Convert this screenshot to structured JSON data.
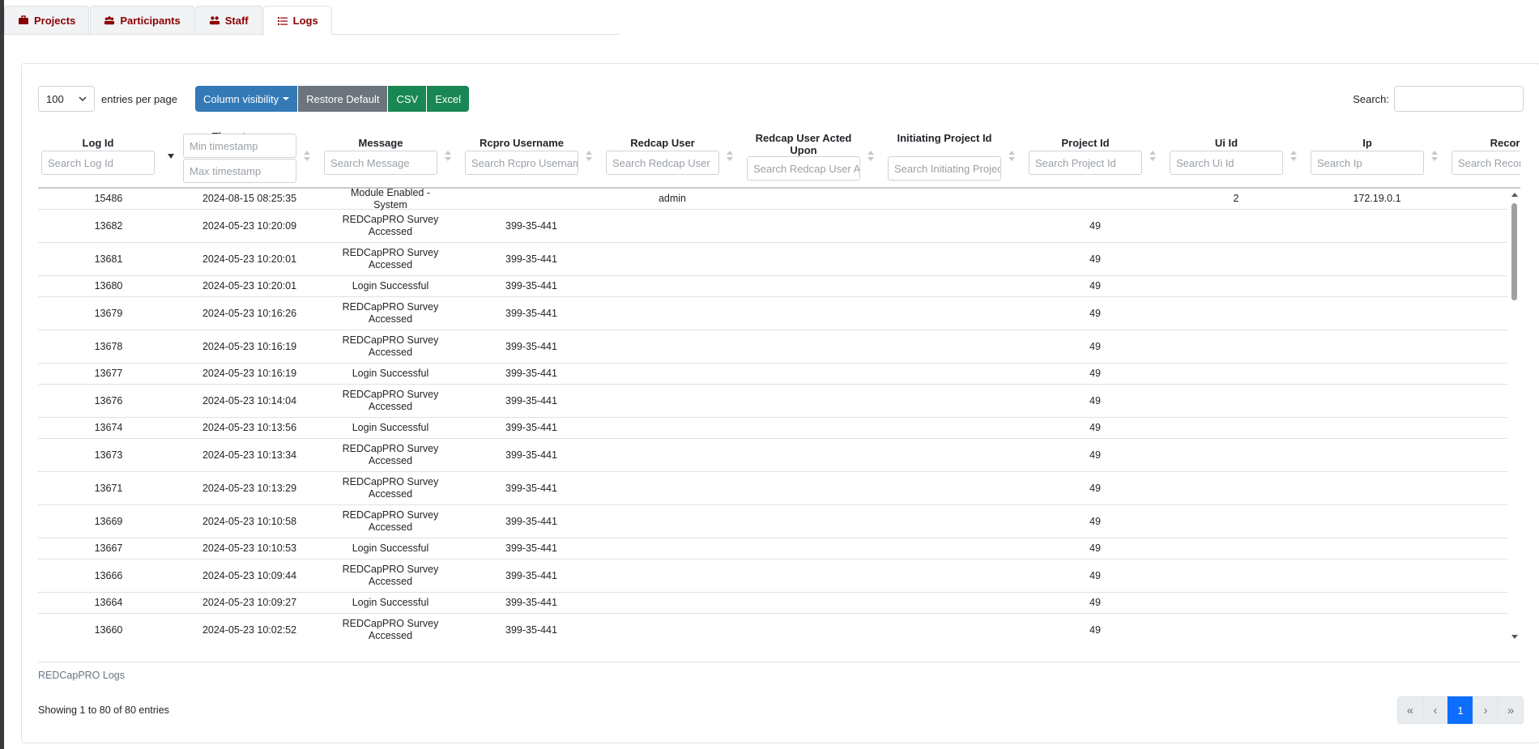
{
  "tabs": [
    {
      "label": "Projects",
      "icon": "briefcase-icon"
    },
    {
      "label": "Participants",
      "icon": "users-icon"
    },
    {
      "label": "Staff",
      "icon": "user-group-icon"
    },
    {
      "label": "Logs",
      "icon": "list-icon"
    }
  ],
  "toolbar": {
    "page_length": "100",
    "page_length_label": "entries per page",
    "column_visibility": "Column visibility",
    "restore_default": "Restore Default",
    "csv": "CSV",
    "excel": "Excel",
    "search_label": "Search:"
  },
  "columns": [
    {
      "title": "Log Id",
      "placeholder": "Search Log Id"
    },
    {
      "title": "Timestamp",
      "placeholder": "Min timestamp",
      "placeholder2": "Max timestamp"
    },
    {
      "title": "Message",
      "placeholder": "Search Message"
    },
    {
      "title": "Rcpro Username",
      "placeholder": "Search Rcpro Username"
    },
    {
      "title": "Redcap User",
      "placeholder": "Search Redcap User"
    },
    {
      "title": "Redcap User Acted Upon",
      "placeholder": "Search Redcap User Acted Upon"
    },
    {
      "title": "Initiating Project Id",
      "placeholder": "Search Initiating Project Id"
    },
    {
      "title": "Project Id",
      "placeholder": "Search Project Id"
    },
    {
      "title": "Ui Id",
      "placeholder": "Search Ui Id"
    },
    {
      "title": "Ip",
      "placeholder": "Search Ip"
    },
    {
      "title": "Record",
      "placeholder": "Search Record"
    }
  ],
  "rows": [
    {
      "log_id": "15486",
      "timestamp": "2024-08-15 08:25:35",
      "message": "Module Enabled - System",
      "rcpro_username": "",
      "redcap_user": "admin",
      "project_id": "",
      "ui_id": "2",
      "ip": "172.19.0.1"
    },
    {
      "log_id": "13682",
      "timestamp": "2024-05-23 10:20:09",
      "message": "REDCapPRO Survey Accessed",
      "rcpro_username": "399-35-441",
      "redcap_user": "",
      "project_id": "49",
      "ui_id": "",
      "ip": ""
    },
    {
      "log_id": "13681",
      "timestamp": "2024-05-23 10:20:01",
      "message": "REDCapPRO Survey Accessed",
      "rcpro_username": "399-35-441",
      "redcap_user": "",
      "project_id": "49",
      "ui_id": "",
      "ip": ""
    },
    {
      "log_id": "13680",
      "timestamp": "2024-05-23 10:20:01",
      "message": "Login Successful",
      "rcpro_username": "399-35-441",
      "redcap_user": "",
      "project_id": "49",
      "ui_id": "",
      "ip": ""
    },
    {
      "log_id": "13679",
      "timestamp": "2024-05-23 10:16:26",
      "message": "REDCapPRO Survey Accessed",
      "rcpro_username": "399-35-441",
      "redcap_user": "",
      "project_id": "49",
      "ui_id": "",
      "ip": ""
    },
    {
      "log_id": "13678",
      "timestamp": "2024-05-23 10:16:19",
      "message": "REDCapPRO Survey Accessed",
      "rcpro_username": "399-35-441",
      "redcap_user": "",
      "project_id": "49",
      "ui_id": "",
      "ip": ""
    },
    {
      "log_id": "13677",
      "timestamp": "2024-05-23 10:16:19",
      "message": "Login Successful",
      "rcpro_username": "399-35-441",
      "redcap_user": "",
      "project_id": "49",
      "ui_id": "",
      "ip": ""
    },
    {
      "log_id": "13676",
      "timestamp": "2024-05-23 10:14:04",
      "message": "REDCapPRO Survey Accessed",
      "rcpro_username": "399-35-441",
      "redcap_user": "",
      "project_id": "49",
      "ui_id": "",
      "ip": ""
    },
    {
      "log_id": "13674",
      "timestamp": "2024-05-23 10:13:56",
      "message": "Login Successful",
      "rcpro_username": "399-35-441",
      "redcap_user": "",
      "project_id": "49",
      "ui_id": "",
      "ip": ""
    },
    {
      "log_id": "13673",
      "timestamp": "2024-05-23 10:13:34",
      "message": "REDCapPRO Survey Accessed",
      "rcpro_username": "399-35-441",
      "redcap_user": "",
      "project_id": "49",
      "ui_id": "",
      "ip": ""
    },
    {
      "log_id": "13671",
      "timestamp": "2024-05-23 10:13:29",
      "message": "REDCapPRO Survey Accessed",
      "rcpro_username": "399-35-441",
      "redcap_user": "",
      "project_id": "49",
      "ui_id": "",
      "ip": ""
    },
    {
      "log_id": "13669",
      "timestamp": "2024-05-23 10:10:58",
      "message": "REDCapPRO Survey Accessed",
      "rcpro_username": "399-35-441",
      "redcap_user": "",
      "project_id": "49",
      "ui_id": "",
      "ip": ""
    },
    {
      "log_id": "13667",
      "timestamp": "2024-05-23 10:10:53",
      "message": "Login Successful",
      "rcpro_username": "399-35-441",
      "redcap_user": "",
      "project_id": "49",
      "ui_id": "",
      "ip": ""
    },
    {
      "log_id": "13666",
      "timestamp": "2024-05-23 10:09:44",
      "message": "REDCapPRO Survey Accessed",
      "rcpro_username": "399-35-441",
      "redcap_user": "",
      "project_id": "49",
      "ui_id": "",
      "ip": ""
    },
    {
      "log_id": "13664",
      "timestamp": "2024-05-23 10:09:27",
      "message": "Login Successful",
      "rcpro_username": "399-35-441",
      "redcap_user": "",
      "project_id": "49",
      "ui_id": "",
      "ip": ""
    },
    {
      "log_id": "13660",
      "timestamp": "2024-05-23 10:02:52",
      "message": "REDCapPRO Survey Accessed",
      "rcpro_username": "399-35-441",
      "redcap_user": "",
      "project_id": "49",
      "ui_id": "",
      "ip": ""
    }
  ],
  "table_caption": "REDCapPRO Logs",
  "info": "Showing 1 to 80 of 80 entries",
  "pagination": {
    "first": "«",
    "prev": "‹",
    "current": "1",
    "next": "›",
    "last": "»"
  }
}
